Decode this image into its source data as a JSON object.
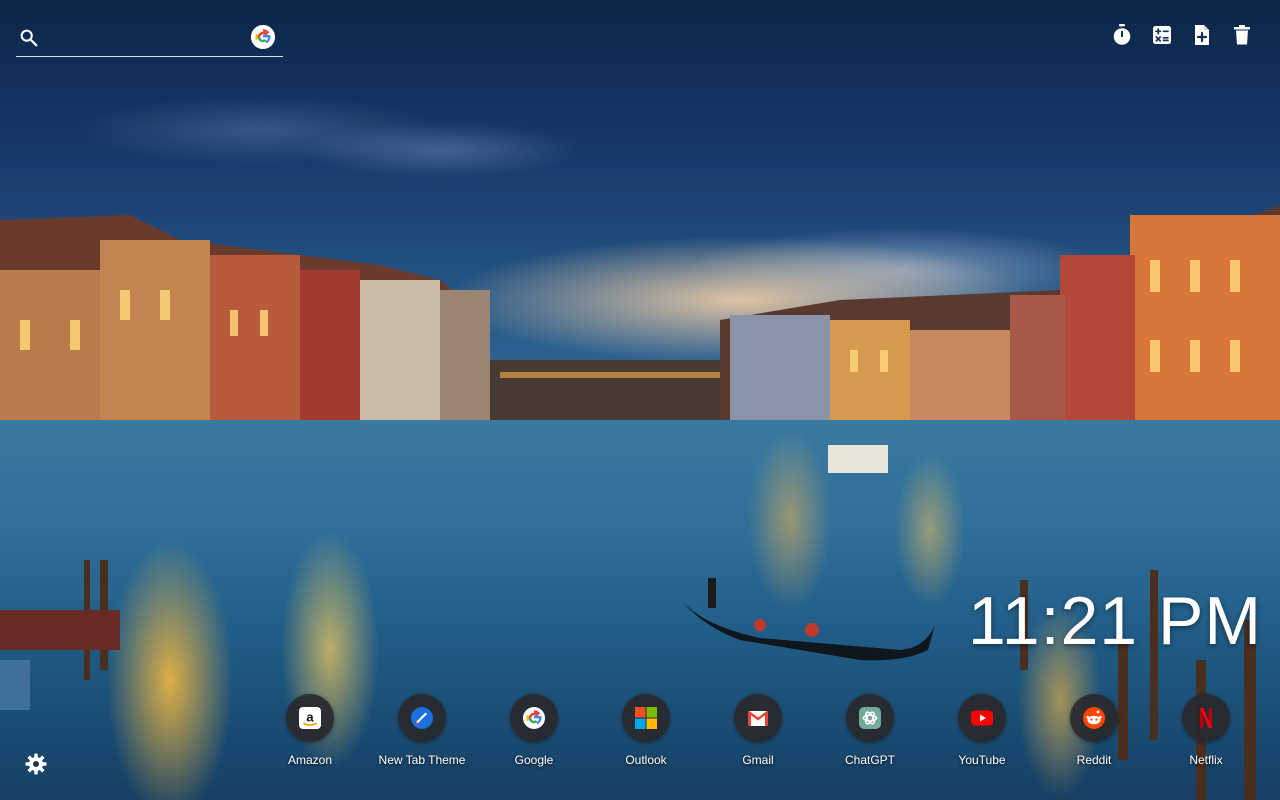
{
  "search": {
    "placeholder": "",
    "value": "",
    "engine_icon": "google-icon"
  },
  "toolbar": {
    "items": [
      {
        "name": "timer-icon"
      },
      {
        "name": "calculator-icon"
      },
      {
        "name": "new-note-icon"
      },
      {
        "name": "trash-icon"
      }
    ]
  },
  "clock": {
    "time": "11:21 PM"
  },
  "shortcuts": [
    {
      "label": "Amazon",
      "icon": "amazon-icon"
    },
    {
      "label": "New Tab Theme",
      "icon": "new-tab-theme-icon"
    },
    {
      "label": "Google",
      "icon": "google-icon"
    },
    {
      "label": "Outlook",
      "icon": "outlook-icon"
    },
    {
      "label": "Gmail",
      "icon": "gmail-icon"
    },
    {
      "label": "ChatGPT",
      "icon": "chatgpt-icon"
    },
    {
      "label": "YouTube",
      "icon": "youtube-icon"
    },
    {
      "label": "Reddit",
      "icon": "reddit-icon"
    },
    {
      "label": "Netflix",
      "icon": "netflix-icon"
    }
  ],
  "settings": {
    "icon": "gear-icon"
  },
  "colors": {
    "text": "#ffffff",
    "tile_bg": "#28282c",
    "sky_top": "#0d2548",
    "water": "#2e6e98"
  }
}
